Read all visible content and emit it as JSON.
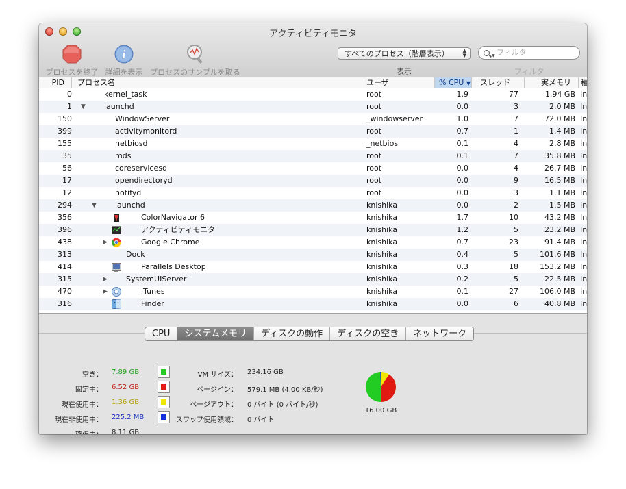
{
  "window": {
    "title": "アクティビティモニタ"
  },
  "toolbar": {
    "quit_label": "プロセスを終了",
    "inspect_label": "詳細を表示",
    "sample_label": "プロセスのサンプルを取る",
    "filter_select_value": "すべてのプロセス（階層表示）",
    "display_label": "表示",
    "search_placeholder": "フィルタ",
    "filter_label": "フィルタ"
  },
  "table": {
    "columns": [
      "PID",
      "プロセス名",
      "ユーザ",
      "% CPU",
      "スレッド",
      "実メモリ",
      "種"
    ],
    "sorted_column": "% CPU",
    "rows": [
      {
        "pid": "0",
        "name": "kernel_task",
        "user": "root",
        "cpu": "1.9",
        "threads": "77",
        "mem": "1.94 GB",
        "kind": "In"
      },
      {
        "pid": "1",
        "name": "launchd",
        "user": "root",
        "cpu": "0.0",
        "threads": "3",
        "mem": "2.0 MB",
        "kind": "In"
      },
      {
        "pid": "150",
        "name": "WindowServer",
        "user": "_windowserver",
        "cpu": "1.0",
        "threads": "7",
        "mem": "72.0 MB",
        "kind": "In"
      },
      {
        "pid": "399",
        "name": "activitymonitord",
        "user": "root",
        "cpu": "0.7",
        "threads": "1",
        "mem": "1.4 MB",
        "kind": "In"
      },
      {
        "pid": "155",
        "name": "netbiosd",
        "user": "_netbios",
        "cpu": "0.1",
        "threads": "4",
        "mem": "2.8 MB",
        "kind": "In"
      },
      {
        "pid": "35",
        "name": "mds",
        "user": "root",
        "cpu": "0.1",
        "threads": "7",
        "mem": "35.8 MB",
        "kind": "In"
      },
      {
        "pid": "56",
        "name": "coreservicesd",
        "user": "root",
        "cpu": "0.0",
        "threads": "4",
        "mem": "26.7 MB",
        "kind": "In"
      },
      {
        "pid": "17",
        "name": "opendirectoryd",
        "user": "root",
        "cpu": "0.0",
        "threads": "9",
        "mem": "16.5 MB",
        "kind": "In"
      },
      {
        "pid": "12",
        "name": "notifyd",
        "user": "root",
        "cpu": "0.0",
        "threads": "3",
        "mem": "1.1 MB",
        "kind": "In"
      },
      {
        "pid": "294",
        "name": "launchd",
        "user": "knishika",
        "cpu": "0.0",
        "threads": "2",
        "mem": "1.5 MB",
        "kind": "In"
      },
      {
        "pid": "356",
        "name": "ColorNavigator 6",
        "user": "knishika",
        "cpu": "1.7",
        "threads": "10",
        "mem": "43.2 MB",
        "kind": "In"
      },
      {
        "pid": "396",
        "name": "アクティビティモニタ",
        "user": "knishika",
        "cpu": "1.2",
        "threads": "5",
        "mem": "23.2 MB",
        "kind": "In"
      },
      {
        "pid": "438",
        "name": "Google Chrome",
        "user": "knishika",
        "cpu": "0.7",
        "threads": "23",
        "mem": "91.4 MB",
        "kind": "In"
      },
      {
        "pid": "313",
        "name": "Dock",
        "user": "knishika",
        "cpu": "0.4",
        "threads": "5",
        "mem": "101.6 MB",
        "kind": "In"
      },
      {
        "pid": "414",
        "name": "Parallels Desktop",
        "user": "knishika",
        "cpu": "0.3",
        "threads": "18",
        "mem": "153.2 MB",
        "kind": "In"
      },
      {
        "pid": "315",
        "name": "SystemUIServer",
        "user": "knishika",
        "cpu": "0.2",
        "threads": "5",
        "mem": "22.5 MB",
        "kind": "In"
      },
      {
        "pid": "470",
        "name": "iTunes",
        "user": "knishika",
        "cpu": "0.1",
        "threads": "27",
        "mem": "106.0 MB",
        "kind": "In"
      },
      {
        "pid": "316",
        "name": "Finder",
        "user": "knishika",
        "cpu": "0.0",
        "threads": "6",
        "mem": "40.8 MB",
        "kind": "In"
      }
    ]
  },
  "tabs": [
    "CPU",
    "システムメモリ",
    "ディスクの動作",
    "ディスクの空き",
    "ネットワーク"
  ],
  "active_tab": "システムメモリ",
  "memory": {
    "free_label": "空き：",
    "free_value": "7.89 GB",
    "wired_label": "固定中：",
    "wired_value": "6.52 GB",
    "active_label": "現在使用中：",
    "active_value": "1.36 GB",
    "inactive_label": "現在非使用中：",
    "inactive_value": "225.2 MB",
    "used_label": "確保中：",
    "used_value": "8.11 GB",
    "vm_label": "VM サイズ：",
    "vm_value": "234.16 GB",
    "pagein_label": "ページイン：",
    "pagein_value": "579.1 MB (4.00 KB/秒)",
    "pageout_label": "ページアウト：",
    "pageout_value": "0 バイト (0 バイト/秒)",
    "swap_label": "スワップ使用領域：",
    "swap_value": "0 バイト",
    "total_label": "16.00 GB",
    "colors": {
      "free": "#22cc22",
      "wired": "#e01a12",
      "active": "#f2e600",
      "inactive": "#1030e0"
    }
  }
}
